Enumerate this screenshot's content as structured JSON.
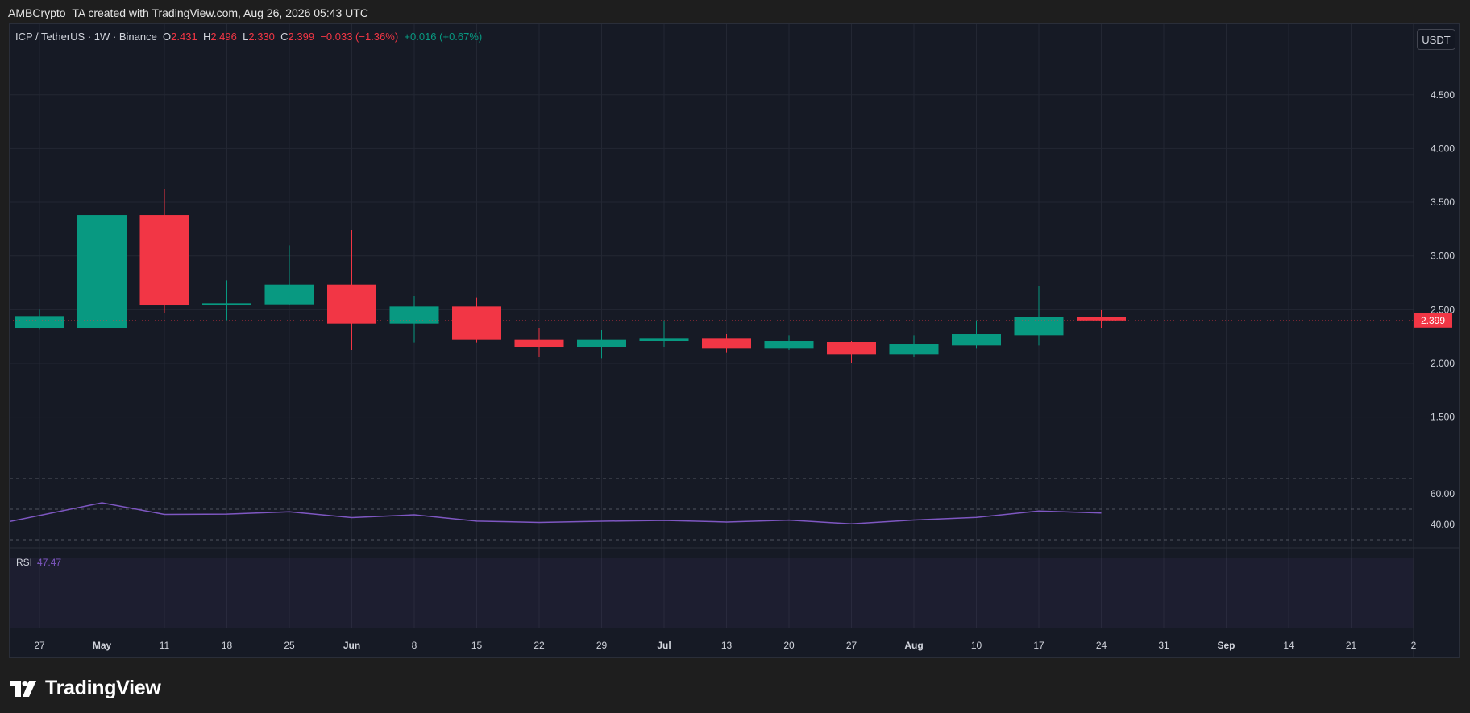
{
  "header": {
    "attribution": "AMBCrypto_TA created with TradingView.com, Aug 26, 2026 05:43 UTC"
  },
  "legend": {
    "symbol": "ICP / TetherUS · 1W · Binance",
    "o_label": "O",
    "o_value": "2.431",
    "h_label": "H",
    "h_value": "2.496",
    "l_label": "L",
    "l_value": "2.330",
    "c_label": "C",
    "c_value": "2.399",
    "change": "−0.033 (−1.36%)",
    "indicator_change": "+0.016 (+0.67%)"
  },
  "currency_button": "USDT",
  "rsi": {
    "label": "RSI",
    "value": "47.47"
  },
  "brand": {
    "name": "TradingView"
  },
  "colors": {
    "up": "#089981",
    "down": "#f23645",
    "rsi_line": "#7e57c2",
    "background": "#161a25"
  },
  "chart_data": {
    "type": "candlestick",
    "price_axis": {
      "ticks": [
        "1.500",
        "2.000",
        "2.500",
        "3.000",
        "3.500",
        "4.000",
        "4.500"
      ],
      "last_price_label": "2.399"
    },
    "time_axis": {
      "ticks": [
        "27",
        "May",
        "11",
        "18",
        "25",
        "Jun",
        "8",
        "15",
        "22",
        "29",
        "Jul",
        "13",
        "20",
        "27",
        "Aug",
        "10",
        "17",
        "24",
        "31",
        "Sep",
        "14",
        "21",
        "2"
      ]
    },
    "candles": [
      {
        "x": "Apr 27",
        "open": 2.33,
        "high": 2.5,
        "low": 2.32,
        "close": 2.44
      },
      {
        "x": "May 4",
        "open": 2.33,
        "high": 4.1,
        "low": 2.31,
        "close": 3.38
      },
      {
        "x": "May 11",
        "open": 3.38,
        "high": 3.62,
        "low": 2.47,
        "close": 2.54
      },
      {
        "x": "May 18",
        "open": 2.54,
        "high": 2.77,
        "low": 2.4,
        "close": 2.56
      },
      {
        "x": "May 25",
        "open": 2.55,
        "high": 3.1,
        "low": 2.54,
        "close": 2.73
      },
      {
        "x": "Jun 1",
        "open": 2.73,
        "high": 3.24,
        "low": 2.12,
        "close": 2.37
      },
      {
        "x": "Jun 8",
        "open": 2.37,
        "high": 2.63,
        "low": 2.19,
        "close": 2.53
      },
      {
        "x": "Jun 15",
        "open": 2.53,
        "high": 2.61,
        "low": 2.19,
        "close": 2.22
      },
      {
        "x": "Jun 22",
        "open": 2.22,
        "high": 2.33,
        "low": 2.06,
        "close": 2.15
      },
      {
        "x": "Jun 29",
        "open": 2.15,
        "high": 2.31,
        "low": 2.05,
        "close": 2.22
      },
      {
        "x": "Jul 6",
        "open": 2.21,
        "high": 2.4,
        "low": 2.15,
        "close": 2.23
      },
      {
        "x": "Jul 13",
        "open": 2.23,
        "high": 2.27,
        "low": 2.1,
        "close": 2.14
      },
      {
        "x": "Jul 20",
        "open": 2.14,
        "high": 2.26,
        "low": 2.12,
        "close": 2.21
      },
      {
        "x": "Jul 27",
        "open": 2.2,
        "high": 2.21,
        "low": 2.0,
        "close": 2.08
      },
      {
        "x": "Aug 3",
        "open": 2.08,
        "high": 2.26,
        "low": 2.06,
        "close": 2.18
      },
      {
        "x": "Aug 10",
        "open": 2.17,
        "high": 2.4,
        "low": 2.14,
        "close": 2.27
      },
      {
        "x": "Aug 17",
        "open": 2.26,
        "high": 2.72,
        "low": 2.17,
        "close": 2.43
      },
      {
        "x": "Aug 24",
        "open": 2.431,
        "high": 2.496,
        "low": 2.33,
        "close": 2.399
      }
    ],
    "rsi": {
      "axis_ticks": [
        "40.00",
        "60.00"
      ],
      "levels": [
        30,
        50,
        70
      ],
      "values": [
        41.9,
        54.2,
        46.6,
        46.8,
        48.3,
        44.5,
        46.3,
        42.2,
        41.3,
        42.1,
        42.6,
        41.6,
        42.8,
        40.4,
        42.9,
        44.6,
        48.8,
        47.47
      ]
    }
  }
}
